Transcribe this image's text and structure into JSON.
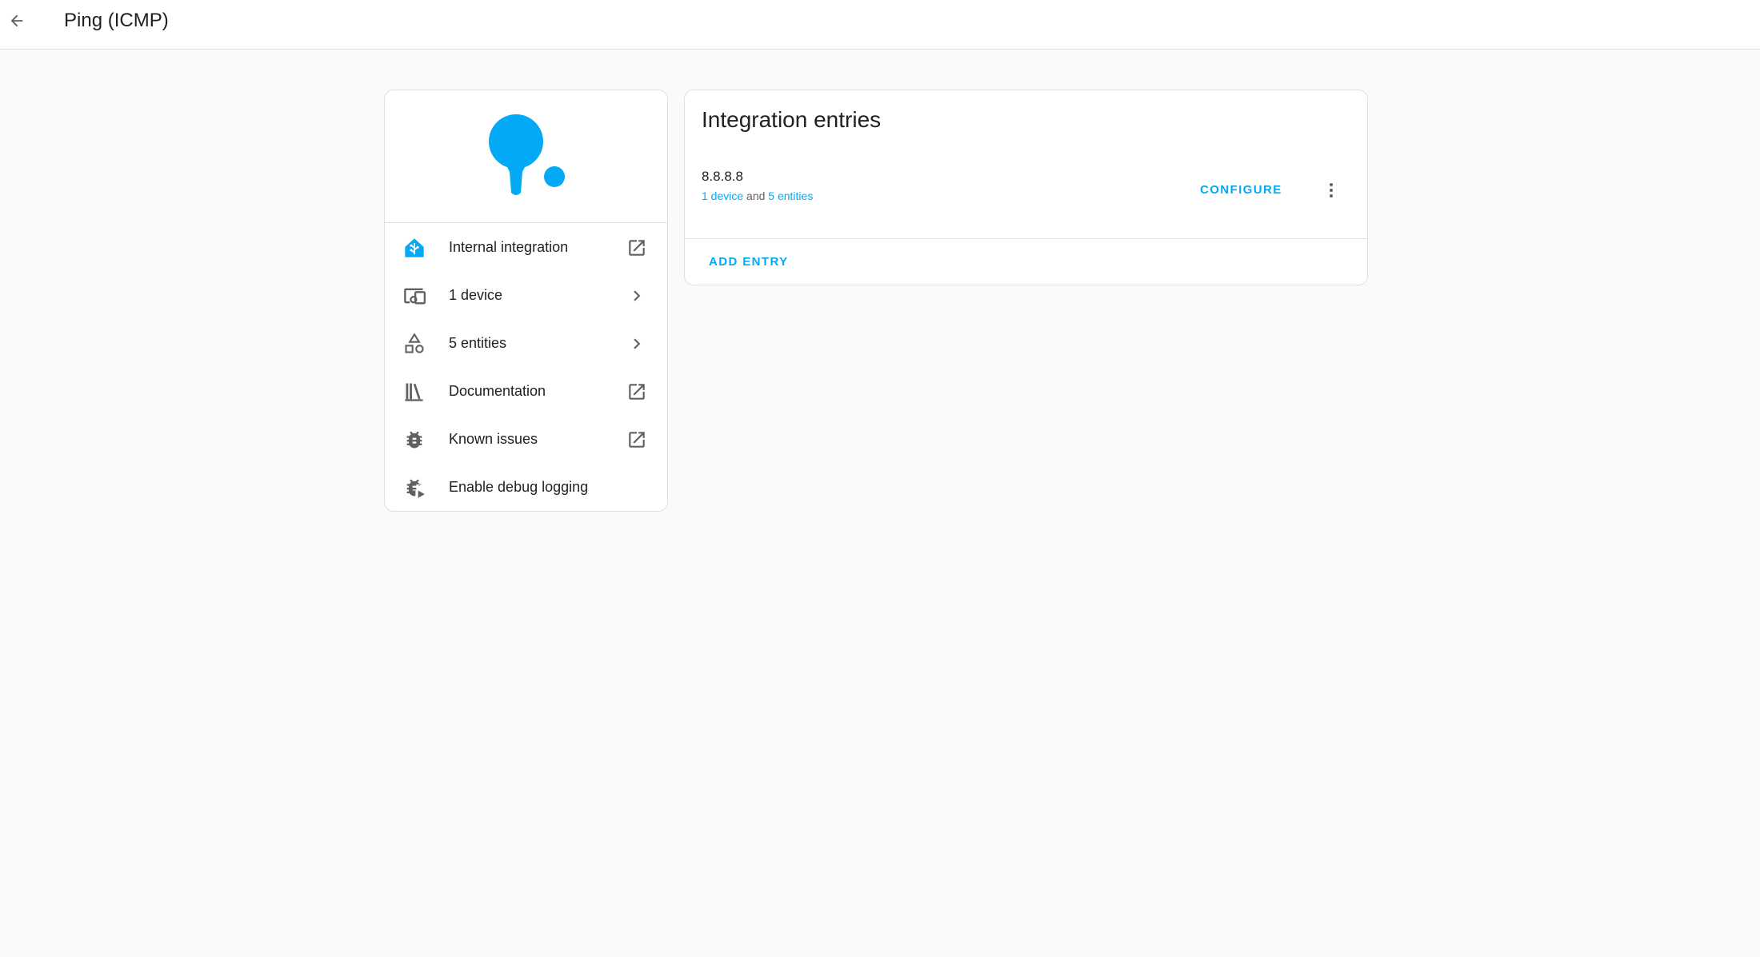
{
  "header": {
    "title": "Ping (ICMP)",
    "back_icon": "arrow-left-icon"
  },
  "info_card": {
    "logo_icon": "ping-pong-paddle-icon",
    "accent_color": "#03a9f4",
    "items": [
      {
        "label": "Internal integration",
        "icon": "home-assistant-icon",
        "trailing_icon": "open-in-new-icon"
      },
      {
        "label": "1 device",
        "icon": "devices-icon",
        "trailing_icon": "chevron-right-icon"
      },
      {
        "label": "5 entities",
        "icon": "shape-outline-icon",
        "trailing_icon": "chevron-right-icon"
      },
      {
        "label": "Documentation",
        "icon": "book-shelf-icon",
        "trailing_icon": "open-in-new-icon"
      },
      {
        "label": "Known issues",
        "icon": "bug-icon",
        "trailing_icon": "open-in-new-icon"
      },
      {
        "label": "Enable debug logging",
        "icon": "bug-play-icon",
        "trailing_icon": ""
      }
    ]
  },
  "entries_card": {
    "title": "Integration entries",
    "entries": [
      {
        "name": "8.8.8.8",
        "devices_link": "1 device",
        "joiner": "and",
        "entities_link": "5 entities",
        "configure_label": "CONFIGURE",
        "menu_icon": "dots-vertical-icon"
      }
    ],
    "add_entry_label": "ADD ENTRY"
  }
}
